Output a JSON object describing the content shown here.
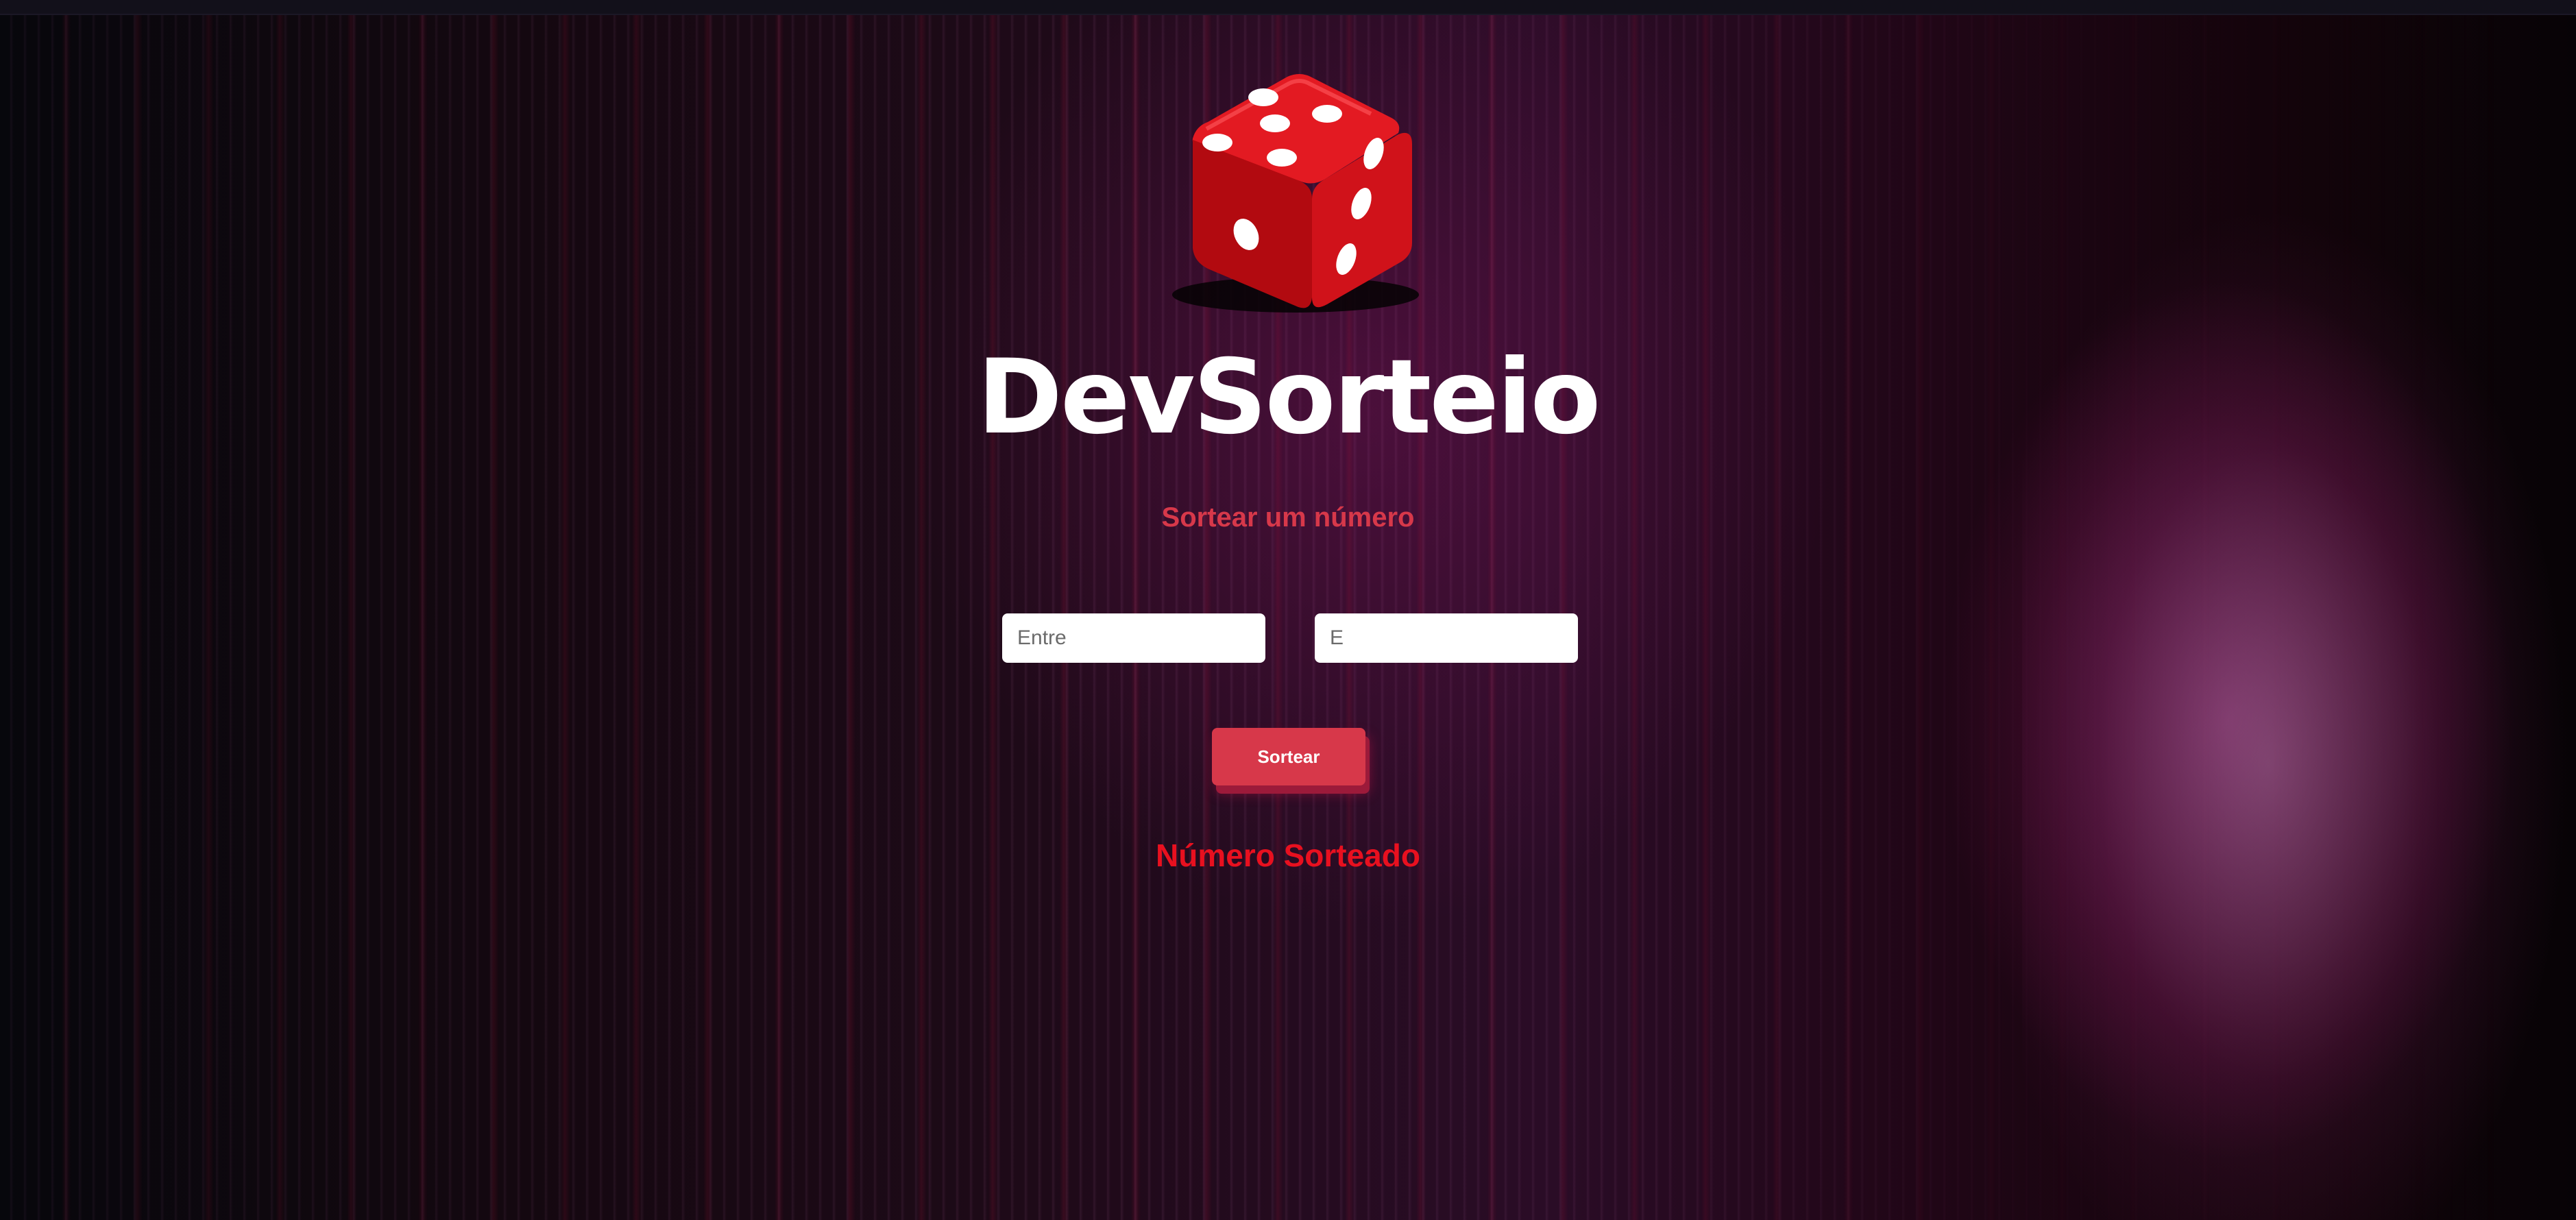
{
  "app": {
    "title": "DevSorteio",
    "subtitle": "Sortear um número",
    "logo_icon": "dice-icon"
  },
  "form": {
    "min_placeholder": "Entre",
    "max_placeholder": "E",
    "min_value": "",
    "max_value": "",
    "submit_label": "Sortear"
  },
  "result": {
    "label": "Número Sorteado"
  },
  "colors": {
    "accent": "#d7384a",
    "result_text": "#e8101f",
    "title_text": "#ffffff",
    "dice_red": "#e0141c"
  }
}
